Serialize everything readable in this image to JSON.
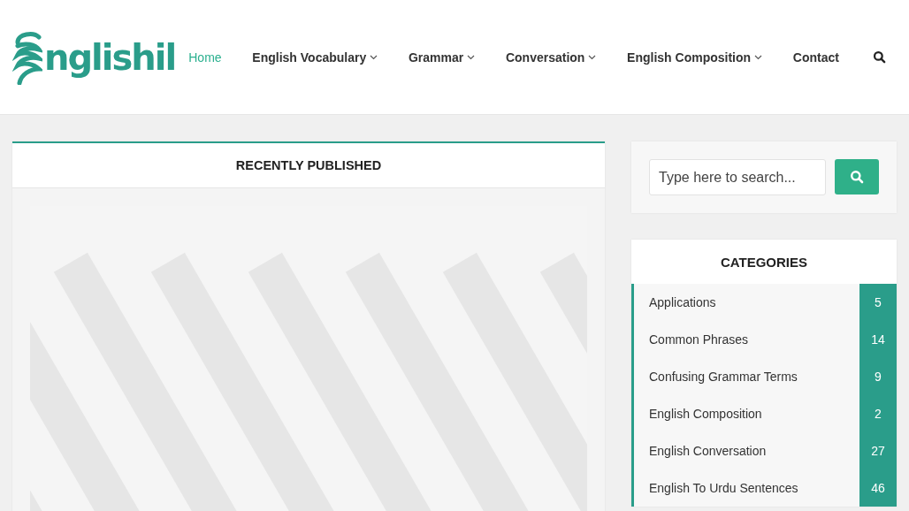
{
  "header": {
    "logo_text": "nglishil",
    "nav": [
      {
        "label": "Home",
        "selected": true,
        "has_dropdown": false
      },
      {
        "label": "English Vocabulary",
        "selected": false,
        "has_dropdown": true
      },
      {
        "label": "Grammar",
        "selected": false,
        "has_dropdown": true
      },
      {
        "label": "Conversation",
        "selected": false,
        "has_dropdown": true
      },
      {
        "label": "English Composition",
        "selected": false,
        "has_dropdown": true
      },
      {
        "label": "Contact",
        "selected": false,
        "has_dropdown": false
      }
    ]
  },
  "recent": {
    "title": "RECENTLY PUBLISHED"
  },
  "search": {
    "placeholder": "Type here to search..."
  },
  "categories": {
    "title": "CATEGORIES",
    "items": [
      {
        "name": "Applications",
        "count": "5"
      },
      {
        "name": "Common Phrases",
        "count": "14"
      },
      {
        "name": "Confusing Grammar Terms",
        "count": "9"
      },
      {
        "name": "English Composition",
        "count": "2"
      },
      {
        "name": "English Conversation",
        "count": "27"
      },
      {
        "name": "English To Urdu Sentences",
        "count": "46"
      }
    ]
  }
}
